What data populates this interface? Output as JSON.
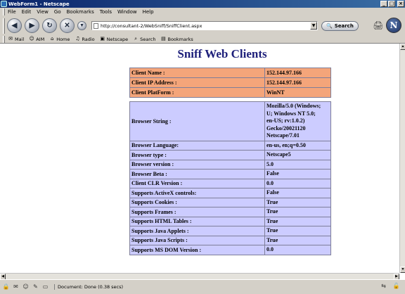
{
  "window": {
    "title": "WebForm1 - Netscape",
    "min_glyph": "_",
    "max_glyph": "□",
    "close_glyph": "×"
  },
  "menu": [
    "File",
    "Edit",
    "View",
    "Go",
    "Bookmarks",
    "Tools",
    "Window",
    "Help"
  ],
  "nav": {
    "back_glyph": "◀",
    "forward_glyph": "▶",
    "reload_glyph": "↻",
    "stop_glyph": "✕",
    "url": "http://consultant-2/WebSniff/SniffClient.aspx",
    "dropdown_glyph": "▼",
    "search_label": "Search",
    "search_icon_glyph": "🔍",
    "print_glyph": "🖨",
    "logo_letter": "N"
  },
  "personal_toolbar": [
    {
      "icon": "✉",
      "label": "Mail"
    },
    {
      "icon": "☺",
      "label": "AIM"
    },
    {
      "icon": "⌂",
      "label": "Home"
    },
    {
      "icon": "♫",
      "label": "Radio"
    },
    {
      "icon": "▣",
      "label": "Netscape"
    },
    {
      "icon": "⌕",
      "label": "Search"
    },
    {
      "icon": "▤",
      "label": "Bookmarks"
    }
  ],
  "page": {
    "heading": "Sniff Web Clients",
    "client_rows": [
      {
        "label": "Client Name :",
        "value": "152.144.97.166"
      },
      {
        "label": "Client IP Address :",
        "value": "152.144.97.166"
      },
      {
        "label": "Client PlatForm :",
        "value": "WinNT"
      }
    ],
    "browser_rows": [
      {
        "label": "Browser String :",
        "value": "Mozilla/5.0 (Windows;\nU; Windows NT 5.0;\nen-US; rv:1.0.2)\nGecko/20021120\nNetscape/7.01"
      },
      {
        "label": "Browser Language:",
        "value": "en-us, en;q=0.50"
      },
      {
        "label": "Browser type :",
        "value": "Netscape5"
      },
      {
        "label": "Browser version :",
        "value": "5.0"
      },
      {
        "label": "Browser Beta :",
        "value": "False"
      },
      {
        "label": "Client CLR Version :",
        "value": "0.0"
      },
      {
        "label": "Supports ActiveX controls:",
        "value": "False"
      },
      {
        "label": "Supports Cookies :",
        "value": "True"
      },
      {
        "label": "Supports Frames :",
        "value": "True"
      },
      {
        "label": "Supports HTML Tables :",
        "value": "True"
      },
      {
        "label": "Supports Java Applets :",
        "value": "True"
      },
      {
        "label": "Supports Java Scripts :",
        "value": "True"
      },
      {
        "label": "Supports MS DOM Version :",
        "value": "0.0"
      }
    ]
  },
  "status": {
    "text": "Document: Done (0.38 secs)",
    "left_icons": [
      "🔒",
      "✉",
      "☺",
      "✎",
      "▭"
    ],
    "right_icons": [
      "⇆",
      "🔓"
    ]
  },
  "colors": {
    "client_table_bg": "#f4a57a",
    "browser_table_bg": "#ccccff",
    "heading": "#1d1f7a"
  }
}
